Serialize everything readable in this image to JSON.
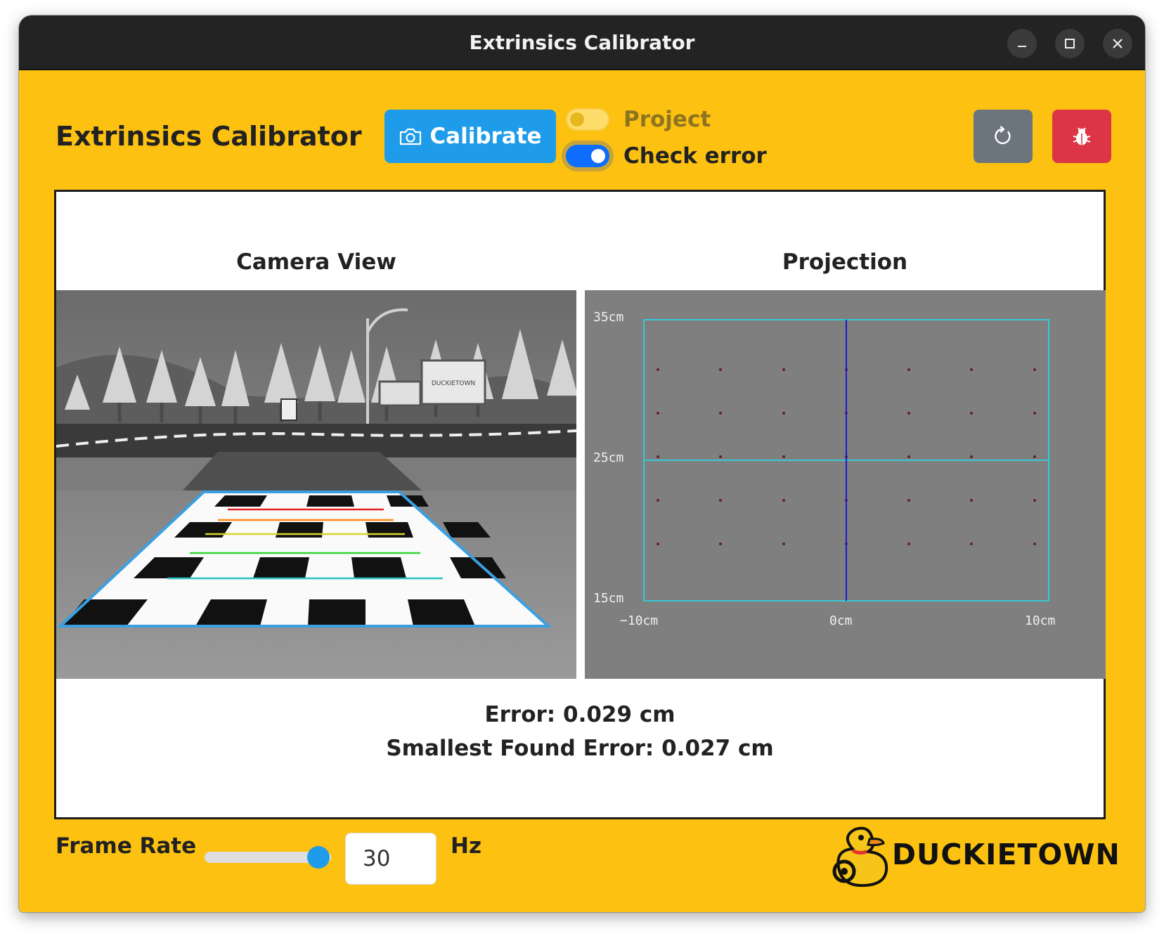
{
  "window": {
    "title": "Extrinsics Calibrator"
  },
  "header": {
    "title": "Extrinsics Calibrator",
    "calibrate_label": "Calibrate",
    "toggles": {
      "project_label": "Project",
      "project_on": false,
      "check_error_label": "Check error",
      "check_error_on": true
    },
    "icons": {
      "calibrate": "camera-icon",
      "refresh": "refresh-icon",
      "bug": "bug-icon"
    }
  },
  "views": {
    "camera_title": "Camera View",
    "projection_title": "Projection",
    "camera_sign_text": "DUCKIETOWN",
    "projection": {
      "y_labels": [
        "35cm",
        "25cm",
        "15cm"
      ],
      "x_labels": [
        "−10cm",
        "0cm",
        "10cm"
      ]
    }
  },
  "results": {
    "error": "Error: 0.029 cm",
    "smallest_error": "Smallest Found Error: 0.027 cm"
  },
  "footer": {
    "frame_rate_label": "Frame Rate",
    "frame_rate_value": "30",
    "frame_rate_fraction": 0.9,
    "unit": "Hz",
    "logo_text": "DUCKIETOWN"
  },
  "colors": {
    "background": "#fcc111",
    "primary_button": "#1e9ce9",
    "secondary_button": "#6c757d",
    "danger_button": "#dc3545",
    "toggle_on": "#0d6efd",
    "projection_grid": "#36c8d8",
    "projection_axis": "#1a1ad0"
  }
}
